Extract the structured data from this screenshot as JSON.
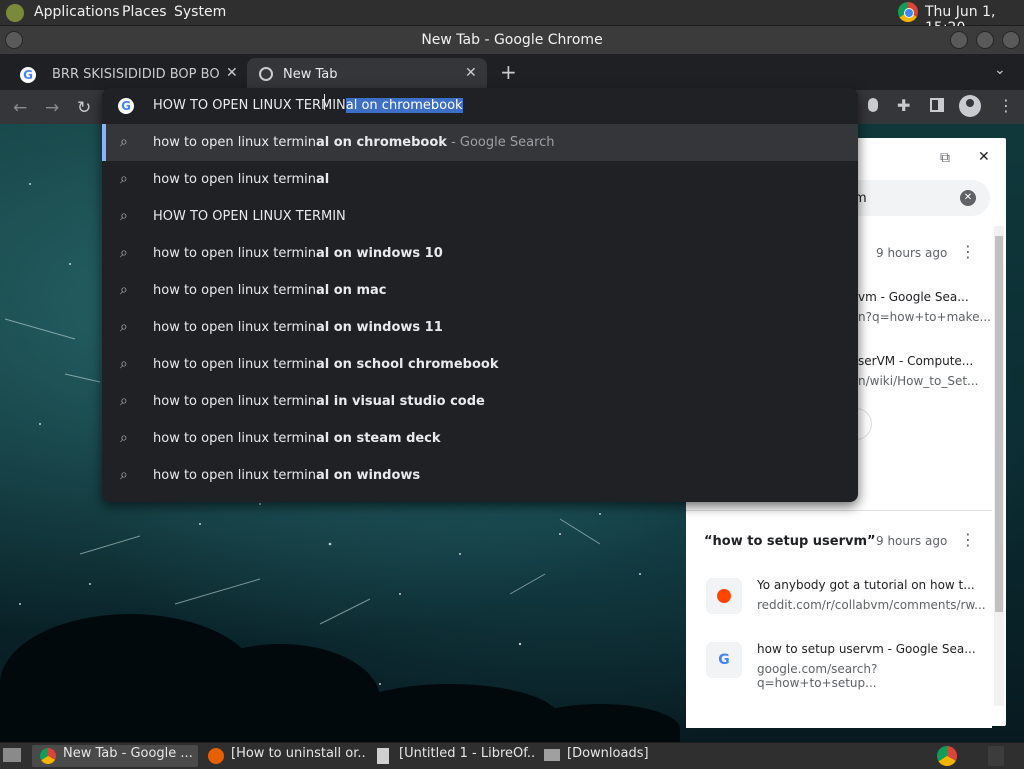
{
  "top_panel": {
    "menus": [
      "Applications",
      "Places",
      "System"
    ],
    "clock": "Thu Jun  1, 15:20"
  },
  "window": {
    "title": "New Tab - Google Chrome"
  },
  "tabs": [
    {
      "title": "BRR SKISISIDIDID BOP BO BOM",
      "active": false
    },
    {
      "title": "New Tab",
      "active": true
    }
  ],
  "omnibox": {
    "typed": "HOW TO OPEN LINUX TERMIN",
    "completion": "al on chromebook",
    "suggestions": [
      {
        "plain": "how to open linux termin",
        "bold": "al on chromebook",
        "suffix": " - Google Search"
      },
      {
        "plain": "how to open linux termin",
        "bold": "al",
        "suffix": ""
      },
      {
        "plain": "HOW TO OPEN LINUX TERMIN",
        "bold": "",
        "suffix": ""
      },
      {
        "plain": "how to open linux termin",
        "bold": "al on windows 10",
        "suffix": ""
      },
      {
        "plain": "how to open linux termin",
        "bold": "al on mac",
        "suffix": ""
      },
      {
        "plain": "how to open linux termin",
        "bold": "al on windows 11",
        "suffix": ""
      },
      {
        "plain": "how to open linux termin",
        "bold": "al on school chromebook",
        "suffix": ""
      },
      {
        "plain": "how to open linux termin",
        "bold": "al in visual studio code",
        "suffix": ""
      },
      {
        "plain": "how to open linux termin",
        "bold": "al on steam deck",
        "suffix": ""
      },
      {
        "plain": "how to open linux termin",
        "bold": "al on windows",
        "suffix": ""
      }
    ]
  },
  "side_panel": {
    "search_value": "m",
    "journey1": {
      "time": "9 hours ago",
      "item1_title": "vm - Google Sea...",
      "item1_url": "n?q=how+to+make...",
      "item2_title": "serVM - Compute...",
      "item2_url": "n/wiki/How_to_Set..."
    },
    "journey2": {
      "title": "“how to setup uservm”",
      "time": "9 hours ago",
      "item1_title": "Yo anybody got a tutorial on how t...",
      "item1_url": "reddit.com/r/collabvm/comments/rw...",
      "item2_title": "how to setup uservm - Google Sea...",
      "item2_url": "google.com/search?q=how+to+setup..."
    }
  },
  "taskbar": {
    "items": [
      "New Tab - Google ...",
      "[How to uninstall or...",
      "[Untitled 1 - LibreOf...",
      "[Downloads]"
    ]
  },
  "colors": {
    "accent_blue": "#8ab4f8",
    "selection": "#3d6fc7",
    "dropdown_bg": "#202124"
  }
}
